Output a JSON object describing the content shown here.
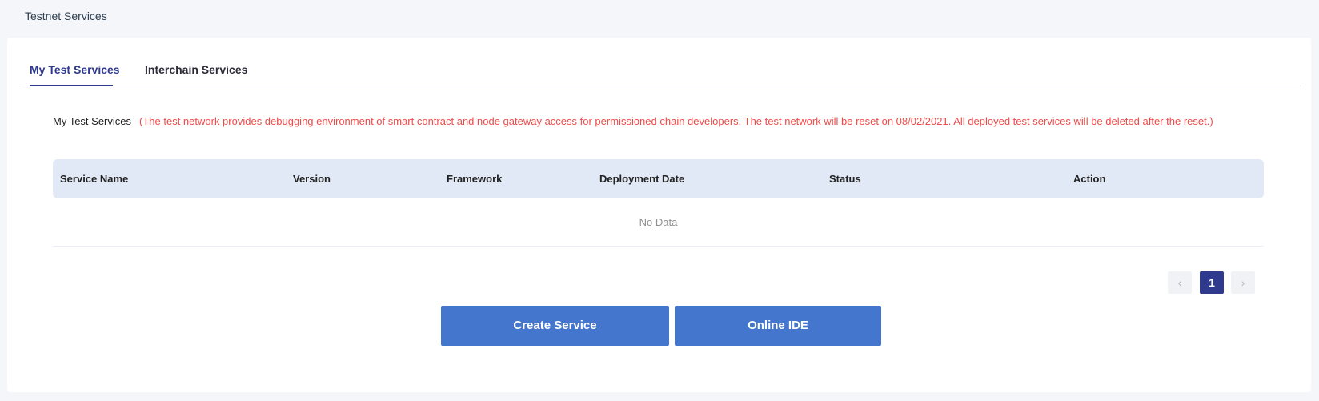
{
  "header": {
    "title": "Testnet Services"
  },
  "tabs": [
    {
      "label": "My Test Services",
      "active": true
    },
    {
      "label": "Interchain Services",
      "active": false
    }
  ],
  "notice": {
    "label": "My Test Services",
    "message": "(The test network provides debugging environment of smart contract and node gateway access for permissioned chain developers. The test network will be reset on 08/02/2021. All deployed test services will be deleted after the reset.)"
  },
  "table": {
    "columns": [
      "Service Name",
      "Version",
      "Framework",
      "Deployment Date",
      "Status",
      "Action"
    ],
    "empty_text": "No Data"
  },
  "pagination": {
    "prev_icon": "chevron-left-icon",
    "next_icon": "chevron-right-icon",
    "prev_glyph": "‹",
    "next_glyph": "›",
    "current_page": "1"
  },
  "actions": {
    "create_label": "Create Service",
    "ide_label": "Online IDE"
  },
  "colors": {
    "accent": "#2f3a8f",
    "button": "#4376cc",
    "warning": "#f24a4a",
    "table_header_bg": "#e2e9f6"
  }
}
